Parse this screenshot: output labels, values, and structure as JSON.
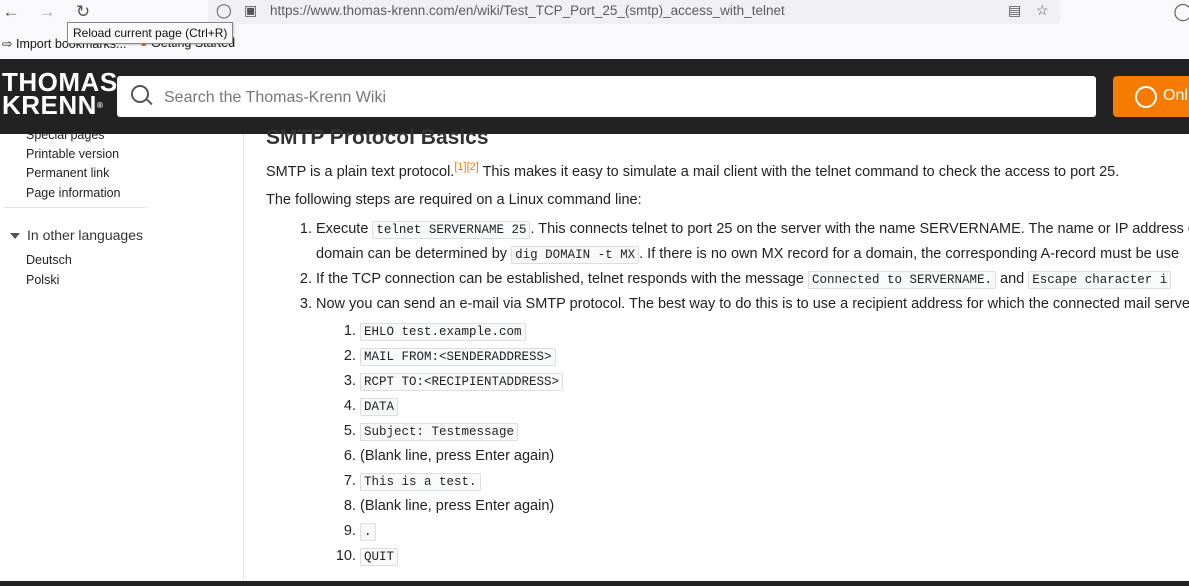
{
  "browser": {
    "url": "https://www.thomas-krenn.com/en/wiki/Test_TCP_Port_25_(smtp)_access_with_telnet",
    "tooltip": "Reload current page (Ctrl+R)",
    "bookmarks": [
      "Import bookmarks...",
      "Getting Started"
    ],
    "icons": [
      "back-arrow-icon",
      "forward-arrow-icon",
      "reload-icon",
      "shield-icon",
      "lock-icon",
      "reader-view-icon",
      "star-icon",
      "account-icon"
    ]
  },
  "site": {
    "logo_line1": "THOMAS",
    "logo_line2": "KRENN",
    "logo_mark": "®",
    "search_placeholder": "Search the Thomas-Krenn Wiki",
    "shop_label": "Onl",
    "accent_color": "#f57c00"
  },
  "sidebar": {
    "links": [
      "Special pages",
      "Printable version",
      "Permanent link",
      "Page information"
    ],
    "languages_heading": "In other languages",
    "languages": [
      "Deutsch",
      "Polski"
    ]
  },
  "article": {
    "heading": "SMTP Protocol Basics",
    "intro_a": "SMTP is a plain text protocol.",
    "ref1": "[1]",
    "ref2": "[2]",
    "intro_b": " This makes it easy to simulate a mail client with the telnet command to check the access to port 25.",
    "steps_intro": "The following steps are required on a Linux command line:",
    "step1_a": "Execute ",
    "step1_code": "telnet SERVERNAME 25",
    "step1_b": ". This connects telnet to port 25 on the server with the name SERVERNAME. The name or IP address o",
    "step1_c": "domain can be determined by ",
    "step1_code2": "dig DOMAIN -t MX",
    "step1_d": ". If there is no own MX record for a domain, the corresponding A-record must be use",
    "step2_a": "If the TCP connection can be established, telnet responds with the message ",
    "step2_code": "Connected to SERVERNAME.",
    "step2_b": " and ",
    "step2_code2": "Escape character i",
    "step3": "Now you can send an e-mail via SMTP protocol. The best way to do this is to use a recipient address for which the connected mail server",
    "substeps": [
      {
        "num": "1.",
        "code": "EHLO test.example.com",
        "text": ""
      },
      {
        "num": "2.",
        "code": "MAIL FROM:<SENDERADDRESS>",
        "text": ""
      },
      {
        "num": "3.",
        "code": "RCPT TO:<RECIPIENTADDRESS>",
        "text": ""
      },
      {
        "num": "4.",
        "code": "DATA",
        "text": ""
      },
      {
        "num": "5.",
        "code": "Subject: Testmessage",
        "text": ""
      },
      {
        "num": "6.",
        "code": "",
        "text": "(Blank line, press Enter again)"
      },
      {
        "num": "7.",
        "code": "This is a test.",
        "text": ""
      },
      {
        "num": "8.",
        "code": "",
        "text": "(Blank line, press Enter again)"
      },
      {
        "num": "9.",
        "code": ".",
        "text": ""
      },
      {
        "num": "10.",
        "code": "QUIT",
        "text": ""
      }
    ]
  }
}
